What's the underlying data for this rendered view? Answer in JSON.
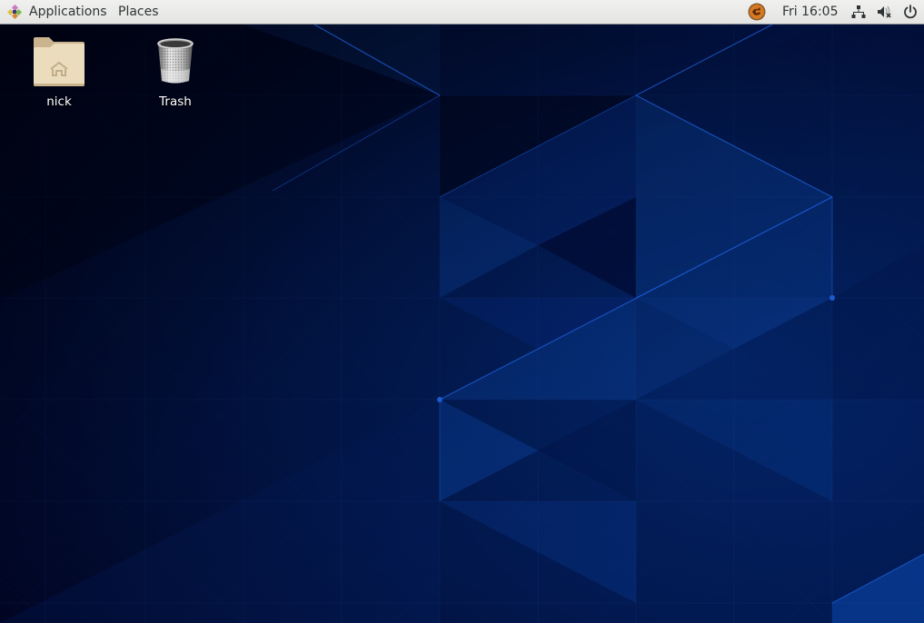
{
  "topbar": {
    "applications_label": "Applications",
    "places_label": "Places",
    "clock": "Fri 16:05",
    "tray": [
      {
        "name": "notification-app-icon",
        "icon": "orange-circle-app-icon"
      },
      {
        "name": "network-icon",
        "icon": "wired-network-icon"
      },
      {
        "name": "volume-icon",
        "icon": "volume-muted-icon"
      },
      {
        "name": "power-icon",
        "icon": "power-icon"
      }
    ]
  },
  "desktop": {
    "icons": [
      {
        "label": "nick",
        "icon": "home-folder-icon"
      },
      {
        "label": "Trash",
        "icon": "trash-icon"
      }
    ]
  },
  "colors": {
    "topbar_bg": "#ececea",
    "wallpaper_dark": "#010628",
    "wallpaper_mid": "#021b56",
    "wallpaper_bright": "#0a3a8a",
    "accent_line": "#1b55c8",
    "folder": "#e8d8b8"
  }
}
